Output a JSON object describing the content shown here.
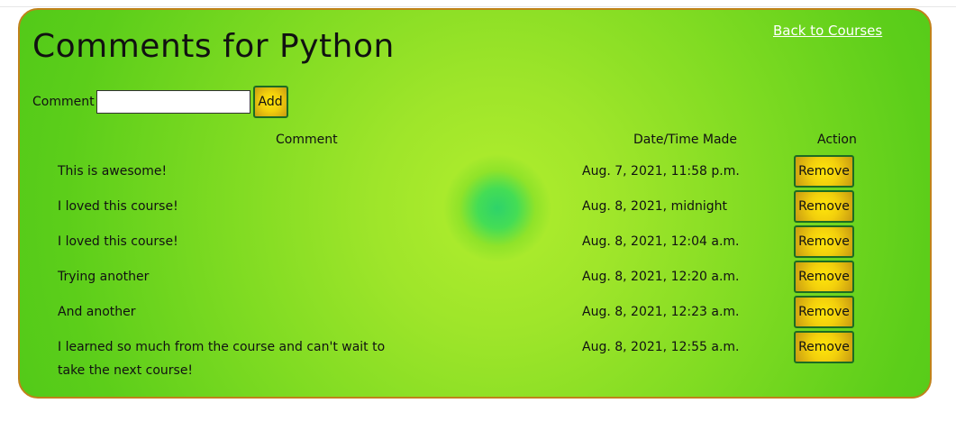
{
  "page": {
    "title": "Comments for Python",
    "back_link": "Back to Courses"
  },
  "form": {
    "label": "Comment",
    "input_value": "",
    "add_label": "Add"
  },
  "table": {
    "headers": {
      "comment": "Comment",
      "date": "Date/Time Made",
      "action": "Action"
    },
    "rows": [
      {
        "comment": "This is awesome!",
        "date": "Aug. 7, 2021, 11:58 p.m.",
        "action": "Remove"
      },
      {
        "comment": "I loved this course!",
        "date": "Aug. 8, 2021, midnight",
        "action": "Remove"
      },
      {
        "comment": "I loved this course!",
        "date": "Aug. 8, 2021, 12:04 a.m.",
        "action": "Remove"
      },
      {
        "comment": "Trying another",
        "date": "Aug. 8, 2021, 12:20 a.m.",
        "action": "Remove"
      },
      {
        "comment": "And another",
        "date": "Aug. 8, 2021, 12:23 a.m.",
        "action": "Remove"
      },
      {
        "comment": "I learned so much from the course and can't wait to take the next course!",
        "date": "Aug. 8, 2021, 12:55 a.m.",
        "action": "Remove"
      }
    ]
  },
  "colors": {
    "panel_border": "#c0821a",
    "panel_green": "#5cce1a",
    "button_yellow": "#f2cf0c",
    "button_border": "#1d6b23",
    "link": "#ffffff"
  }
}
